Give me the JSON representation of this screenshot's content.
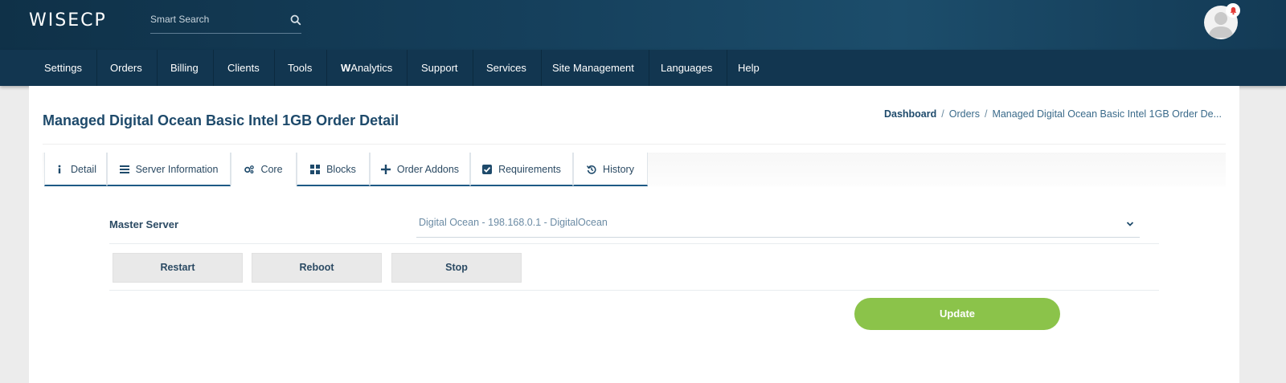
{
  "header": {
    "logo": "WISECP",
    "search_placeholder": "Smart Search"
  },
  "nav": {
    "items": [
      {
        "label": "Settings"
      },
      {
        "label": "Orders"
      },
      {
        "label": "Billing"
      },
      {
        "label": "Clients"
      },
      {
        "label": "Tools"
      },
      {
        "prefix": "W",
        "label": "Analytics"
      },
      {
        "label": "Support"
      },
      {
        "label": "Services"
      },
      {
        "label": "Site Management"
      },
      {
        "label": "Languages"
      },
      {
        "label": "Help"
      }
    ]
  },
  "page": {
    "title": "Managed Digital Ocean Basic Intel 1GB Order Detail",
    "breadcrumb": [
      "Dashboard",
      "Orders",
      "Managed Digital Ocean Basic Intel 1GB Order De..."
    ]
  },
  "tabs": [
    {
      "label": "Detail",
      "icon": "info-icon"
    },
    {
      "label": "Server Information",
      "icon": "server-list-icon"
    },
    {
      "label": "Core",
      "icon": "cogs-icon",
      "active": true
    },
    {
      "label": "Blocks",
      "icon": "grid-icon"
    },
    {
      "label": "Order Addons",
      "icon": "plus-icon"
    },
    {
      "label": "Requirements",
      "icon": "check-square-icon"
    },
    {
      "label": "History",
      "icon": "history-icon"
    }
  ],
  "core": {
    "master_server_label": "Master Server",
    "master_server_value": "Digital Ocean - 198.168.0.1 - DigitalOcean",
    "buttons": {
      "restart": "Restart",
      "reboot": "Reboot",
      "stop": "Stop"
    },
    "update_label": "Update"
  },
  "colors": {
    "header_bg": "#133a55",
    "nav_bg": "#123650",
    "title": "#1e4a6b",
    "tab_underline": "#1e5a85",
    "update_button": "#8bc34a",
    "notification": "#e53935"
  }
}
